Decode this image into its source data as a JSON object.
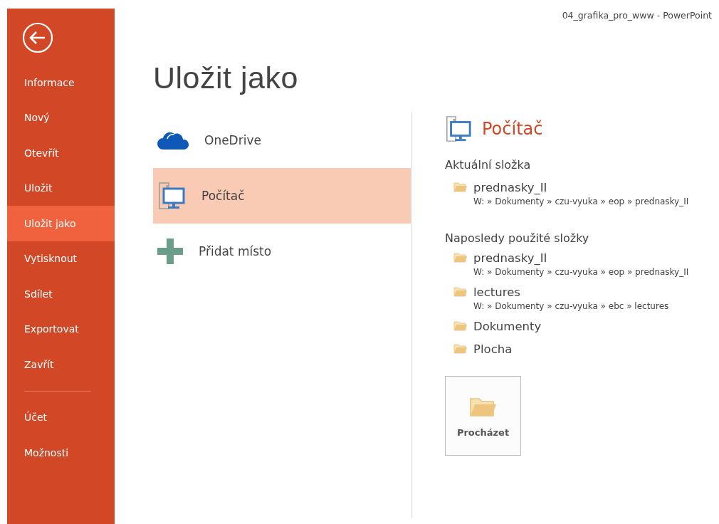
{
  "window": {
    "title": "04_grafika_pro_www - PowerPoint"
  },
  "sidebar": {
    "items": [
      {
        "label": "Informace",
        "selected": false
      },
      {
        "label": "Nový",
        "selected": false
      },
      {
        "label": "Otevřít",
        "selected": false
      },
      {
        "label": "Uložit",
        "selected": false
      },
      {
        "label": "Uložit jako",
        "selected": true
      },
      {
        "label": "Vytisknout",
        "selected": false
      },
      {
        "label": "Sdílet",
        "selected": false
      },
      {
        "label": "Exportovat",
        "selected": false
      },
      {
        "label": "Zavřít",
        "selected": false
      },
      {
        "kind": "separator"
      },
      {
        "label": "Účet",
        "selected": false
      },
      {
        "label": "Možnosti",
        "selected": false
      }
    ]
  },
  "page_title": "Uložit jako",
  "places": [
    {
      "kind": "cloud",
      "label": "OneDrive",
      "selected": false
    },
    {
      "kind": "computer",
      "label": "Počítač",
      "selected": true
    },
    {
      "kind": "add",
      "label": "Přidat místo",
      "selected": false
    }
  ],
  "detail": {
    "title": "Počítač",
    "current_heading": "Aktuální složka",
    "current": [
      {
        "name": "prednasky_II",
        "path": "W: » Dokumenty » czu-vyuka » eop » prednasky_II"
      }
    ],
    "recent_heading": "Naposledy použité složky",
    "recent": [
      {
        "name": "prednasky_II",
        "path": "W: » Dokumenty » czu-vyuka » eop » prednasky_II"
      },
      {
        "name": "lectures",
        "path": "W: » Dokumenty » czu-vyuka » ebc » lectures"
      },
      {
        "name": "Dokumenty"
      },
      {
        "name": "Plocha"
      }
    ],
    "browse_button": "Procházet"
  }
}
